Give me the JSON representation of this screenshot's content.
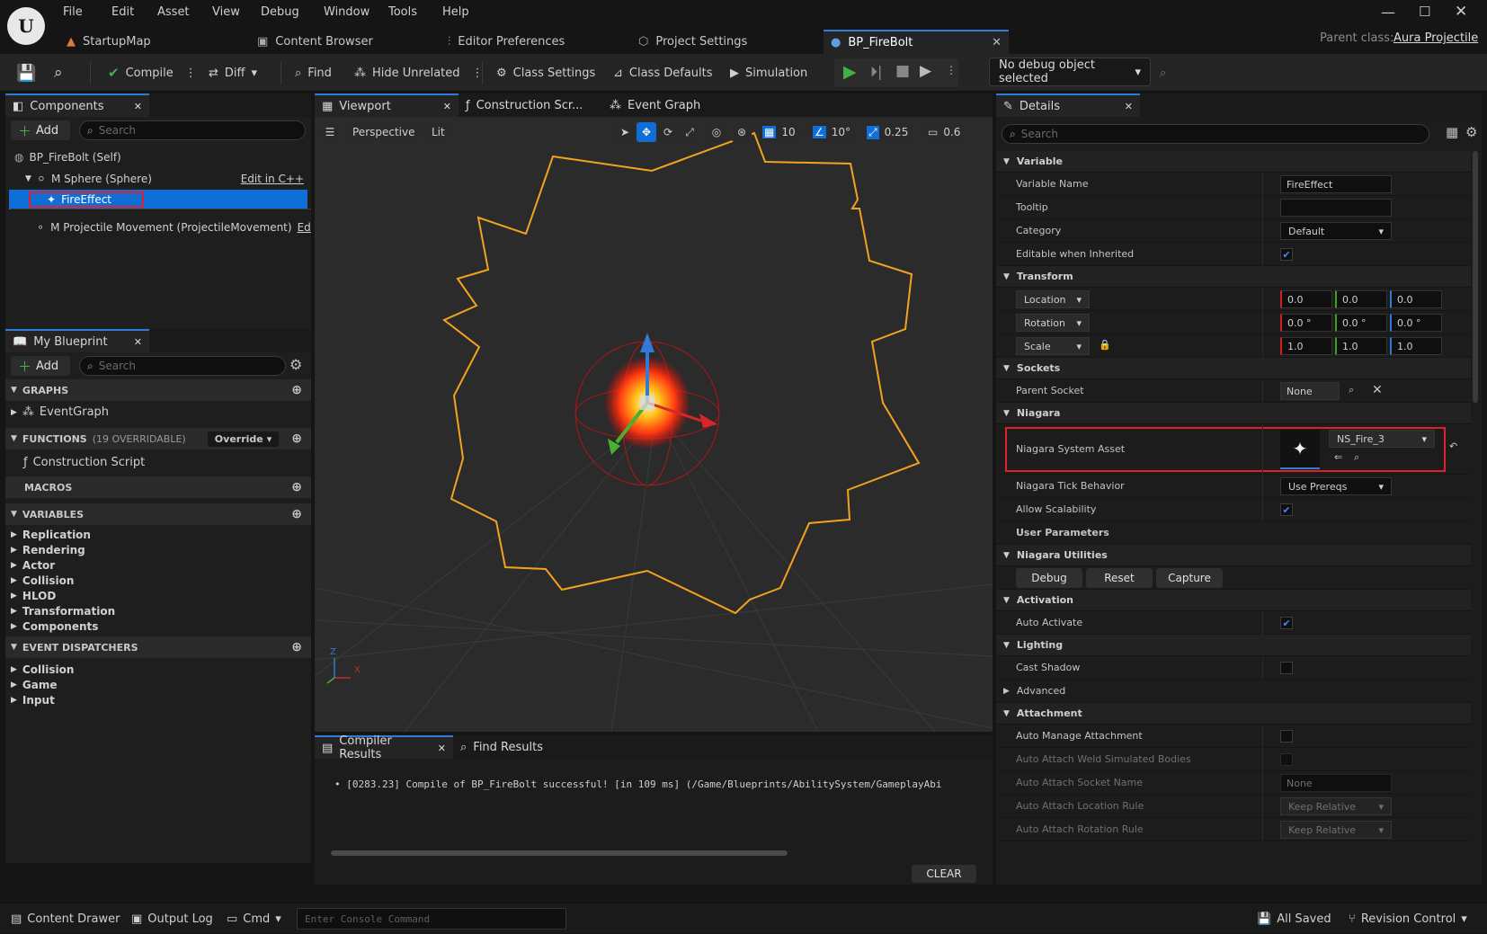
{
  "menu": [
    "File",
    "Edit",
    "Asset",
    "View",
    "Debug",
    "Window",
    "Tools",
    "Help"
  ],
  "doc_tabs": [
    "StartupMap",
    "Content Browser",
    "Editor Preferences",
    "Project Settings",
    "BP_FireBolt"
  ],
  "parent_class": {
    "label": "Parent class:",
    "value": "Aura Projectile"
  },
  "toolbar": {
    "compile": "Compile",
    "diff": "Diff",
    "find": "Find",
    "hide_unrelated": "Hide Unrelated",
    "class_settings": "Class Settings",
    "class_defaults": "Class Defaults",
    "simulation": "Simulation",
    "debug_object": "No debug object selected"
  },
  "components": {
    "tab": "Components",
    "add": "Add",
    "search_placeholder": "Search",
    "items": [
      {
        "label": "BP_FireBolt (Self)"
      },
      {
        "label": "M Sphere (Sphere)",
        "extra": "Edit in C++"
      },
      {
        "label": "FireEffect"
      },
      {
        "label": "M Projectile Movement (ProjectileMovement)",
        "extra": "Ed"
      }
    ]
  },
  "my_blueprint": {
    "tab": "My Blueprint",
    "add": "Add",
    "search_placeholder": "Search",
    "graphs": "GRAPHS",
    "event_graph": "EventGraph",
    "functions": "FUNCTIONS",
    "functions_count": "(19 OVERRIDABLE)",
    "override": "Override",
    "construction_script": "Construction Script",
    "macros": "MACROS",
    "variables": "VARIABLES",
    "variable_groups": [
      "Replication",
      "Rendering",
      "Actor",
      "Collision",
      "HLOD",
      "Transformation",
      "Components"
    ],
    "event_dispatchers": "EVENT DISPATCHERS",
    "dispatcher_groups": [
      "Collision",
      "Game",
      "Input"
    ]
  },
  "center_tabs": [
    "Viewport",
    "Construction Scr...",
    "Event Graph"
  ],
  "viewport": {
    "perspective": "Perspective",
    "lit": "Lit",
    "grid_snap": "10",
    "rot_snap": "10°",
    "scale_snap": "0.25",
    "cam_speed": "0.6",
    "axis_x": "X",
    "axis_z": "Z"
  },
  "bottom_tabs": [
    "Compiler Results",
    "Find Results"
  ],
  "compiler_message": "[0283.23] Compile of BP_FireBolt successful! [in 109 ms] (/Game/Blueprints/AbilitySystem/GameplayAbi",
  "clear": "CLEAR",
  "details": {
    "tab": "Details",
    "search_placeholder": "Search",
    "variable": {
      "header": "Variable",
      "variable_name_label": "Variable Name",
      "variable_name": "FireEffect",
      "tooltip_label": "Tooltip",
      "category_label": "Category",
      "category": "Default",
      "editable_label": "Editable when Inherited"
    },
    "transform": {
      "header": "Transform",
      "location": "Location",
      "rotation": "Rotation",
      "scale": "Scale",
      "loc": [
        "0.0",
        "0.0",
        "0.0"
      ],
      "rot": [
        "0.0 °",
        "0.0 °",
        "0.0 °"
      ],
      "scl": [
        "1.0",
        "1.0",
        "1.0"
      ]
    },
    "sockets": {
      "header": "Sockets",
      "parent_socket_label": "Parent Socket",
      "parent_socket": "None"
    },
    "niagara": {
      "header": "Niagara",
      "system_asset_label": "Niagara System Asset",
      "system_asset": "NS_Fire_3",
      "tick_label": "Niagara Tick Behavior",
      "tick": "Use Prereqs",
      "scalability_label": "Allow Scalability",
      "user_params": "User Parameters"
    },
    "utilities": {
      "header": "Niagara Utilities",
      "debug": "Debug",
      "reset": "Reset",
      "capture": "Capture"
    },
    "activation": {
      "header": "Activation",
      "auto_activate": "Auto Activate"
    },
    "lighting": {
      "header": "Lighting",
      "cast_shadow": "Cast Shadow",
      "advanced": "Advanced"
    },
    "attachment": {
      "header": "Attachment",
      "auto_manage": "Auto Manage Attachment",
      "weld": "Auto Attach Weld Simulated Bodies",
      "socket_name_label": "Auto Attach Socket Name",
      "socket_name": "None",
      "loc_rule_label": "Auto Attach Location Rule",
      "loc_rule": "Keep Relative",
      "rot_rule_label": "Auto Attach Rotation Rule",
      "rot_rule": "Keep Relative"
    }
  },
  "statusbar": {
    "content_drawer": "Content Drawer",
    "output_log": "Output Log",
    "cmd": "Cmd",
    "console_placeholder": "Enter Console Command",
    "all_saved": "All Saved",
    "revision_control": "Revision Control"
  }
}
